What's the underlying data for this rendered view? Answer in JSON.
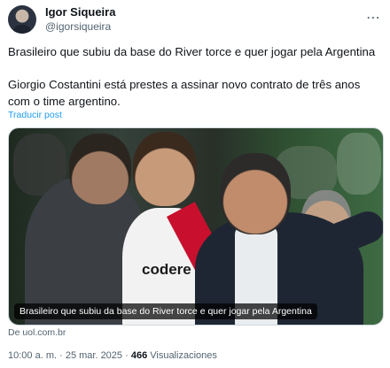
{
  "author": {
    "display_name": "Igor Siqueira",
    "handle": "@igorsiqueira"
  },
  "header": {
    "more_icon": "⋯"
  },
  "tweet": {
    "paragraph1": "Brasileiro que subiu da base do River torce e quer jogar pela Argentina",
    "paragraph2": "Giorgio Costantini está prestes a assinar novo contrato de três anos com o time argentino.",
    "translate_label": "Traducir post"
  },
  "card": {
    "image_caption": "Brasileiro que subiu da base do River torce e quer jogar pela Argentina",
    "sponsor_text": "codere",
    "source": "De uol.com.br"
  },
  "meta": {
    "time": "10:00 a. m.",
    "separator": " · ",
    "date": "25 mar. 2025",
    "views_count": "466",
    "views_label": " Visualizaciones"
  }
}
